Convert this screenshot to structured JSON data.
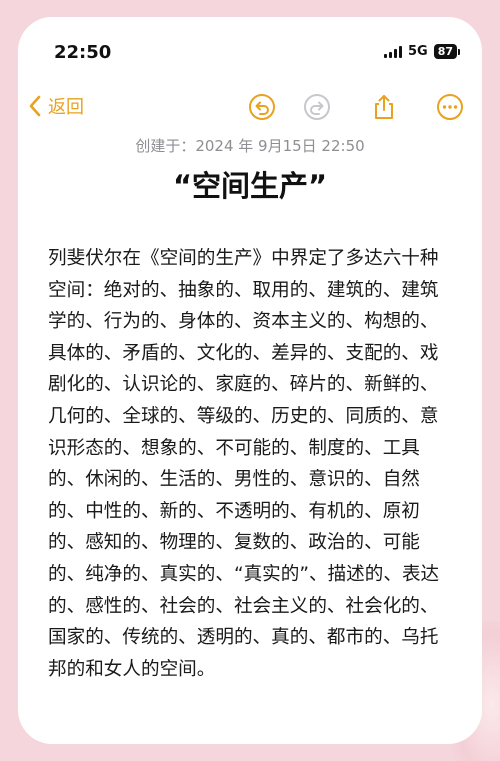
{
  "status_bar": {
    "time": "22:50",
    "network": "5G",
    "battery": "87"
  },
  "toolbar": {
    "back_label": "返回",
    "accent_color": "#e8a21e"
  },
  "note": {
    "created": "创建于：2024 年 9月15日 22:50",
    "title": "“空间生产”",
    "body": "列斐伏尔在《空间的生产》中界定了多达六十种空间：绝对的、抽象的、取用的、建筑的、建筑学的、行为的、身体的、资本主义的、构想的、具体的、矛盾的、文化的、差异的、支配的、戏剧化的、认识论的、家庭的、碎片的、新鲜的、几何的、全球的、等级的、历史的、同质的、意识形态的、想象的、不可能的、制度的、工具的、休闲的、生活的、男性的、意识的、自然的、中性的、新的、不透明的、有机的、原初的、感知的、物理的、复数的、政治的、可能的、纯净的、真实的、“真实的”、描述的、表达的、感性的、社会的、社会主义的、社会化的、国家的、传统的、透明的、真的、都市的、乌托邦的和女人的空间。"
  }
}
